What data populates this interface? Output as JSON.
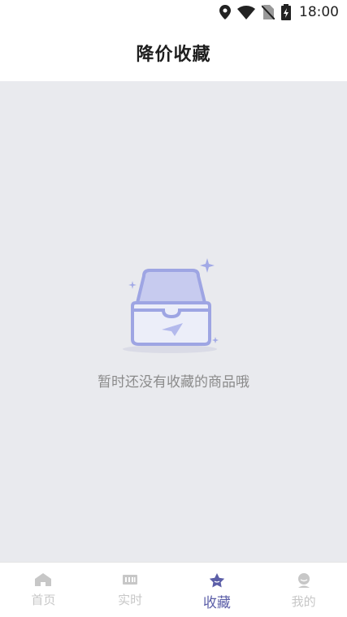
{
  "status_bar": {
    "time": "18:00",
    "icons": [
      "location-icon",
      "wifi-icon",
      "no-sim-icon",
      "battery-charging-icon"
    ]
  },
  "header": {
    "title": "降价收藏"
  },
  "empty_state": {
    "illustration": "empty-box-icon",
    "message": "暂时还没有收藏的商品哦"
  },
  "bottom_nav": {
    "active_color": "#5c5fa8",
    "inactive_color": "#c7c7c7",
    "items": [
      {
        "label": "首页",
        "icon": "home-icon",
        "active": false
      },
      {
        "label": "实时",
        "icon": "keyboard-icon",
        "active": false
      },
      {
        "label": "收藏",
        "icon": "star-icon",
        "active": true
      },
      {
        "label": "我的",
        "icon": "profile-icon",
        "active": false
      }
    ]
  }
}
